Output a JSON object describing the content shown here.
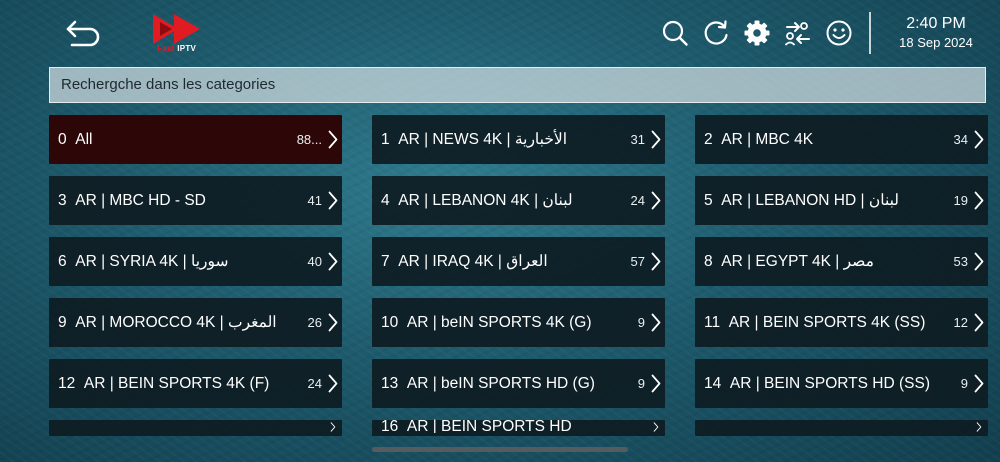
{
  "header": {
    "logo_text_part1": "Fast",
    "logo_text_part2": "IPTV",
    "time": "2:40 PM",
    "date": "18 Sep 2024",
    "icons": [
      "back-arrow-icon",
      "search-icon",
      "refresh-icon",
      "gear-icon",
      "switch-profile-icon",
      "smiley-icon"
    ]
  },
  "search": {
    "placeholder": "Rechergche dans les categories"
  },
  "colors": {
    "tile_bg": "#0e1c22",
    "selected_tile_bg": "#2d0707",
    "logo_red": "#e11b22"
  },
  "categories": [
    {
      "index": "0",
      "label": "All",
      "count": "88..."
    },
    {
      "index": "1",
      "label": "AR | NEWS 4K | الأخبارية",
      "count": "31"
    },
    {
      "index": "2",
      "label": "AR | MBC 4K",
      "count": "34"
    },
    {
      "index": "3",
      "label": "AR | MBC HD - SD",
      "count": "41"
    },
    {
      "index": "4",
      "label": "AR | LEBANON 4K | لبنان",
      "count": "24"
    },
    {
      "index": "5",
      "label": "AR | LEBANON HD | لبنان",
      "count": "19"
    },
    {
      "index": "6",
      "label": "AR | SYRIA 4K | سوريا",
      "count": "40"
    },
    {
      "index": "7",
      "label": "AR | IRAQ 4K | العراق",
      "count": "57"
    },
    {
      "index": "8",
      "label": "AR | EGYPT 4K | مصر",
      "count": "53"
    },
    {
      "index": "9",
      "label": "AR | MOROCCO 4K | المغرب",
      "count": "26"
    },
    {
      "index": "10",
      "label": "AR | beIN SPORTS 4K (G)",
      "count": "9"
    },
    {
      "index": "11",
      "label": "AR | BEIN SPORTS 4K (SS)",
      "count": "12"
    },
    {
      "index": "12",
      "label": "AR | BEIN SPORTS 4K (F)",
      "count": "24"
    },
    {
      "index": "13",
      "label": "AR | beIN SPORTS HD (G)",
      "count": "9"
    },
    {
      "index": "14",
      "label": "AR | BEIN SPORTS HD (SS)",
      "count": "9"
    },
    {
      "index": "",
      "label": "",
      "count": ""
    },
    {
      "index": "16",
      "label": "AR | BEIN SPORTS HD",
      "count": ""
    },
    {
      "index": "",
      "label": "",
      "count": ""
    }
  ]
}
